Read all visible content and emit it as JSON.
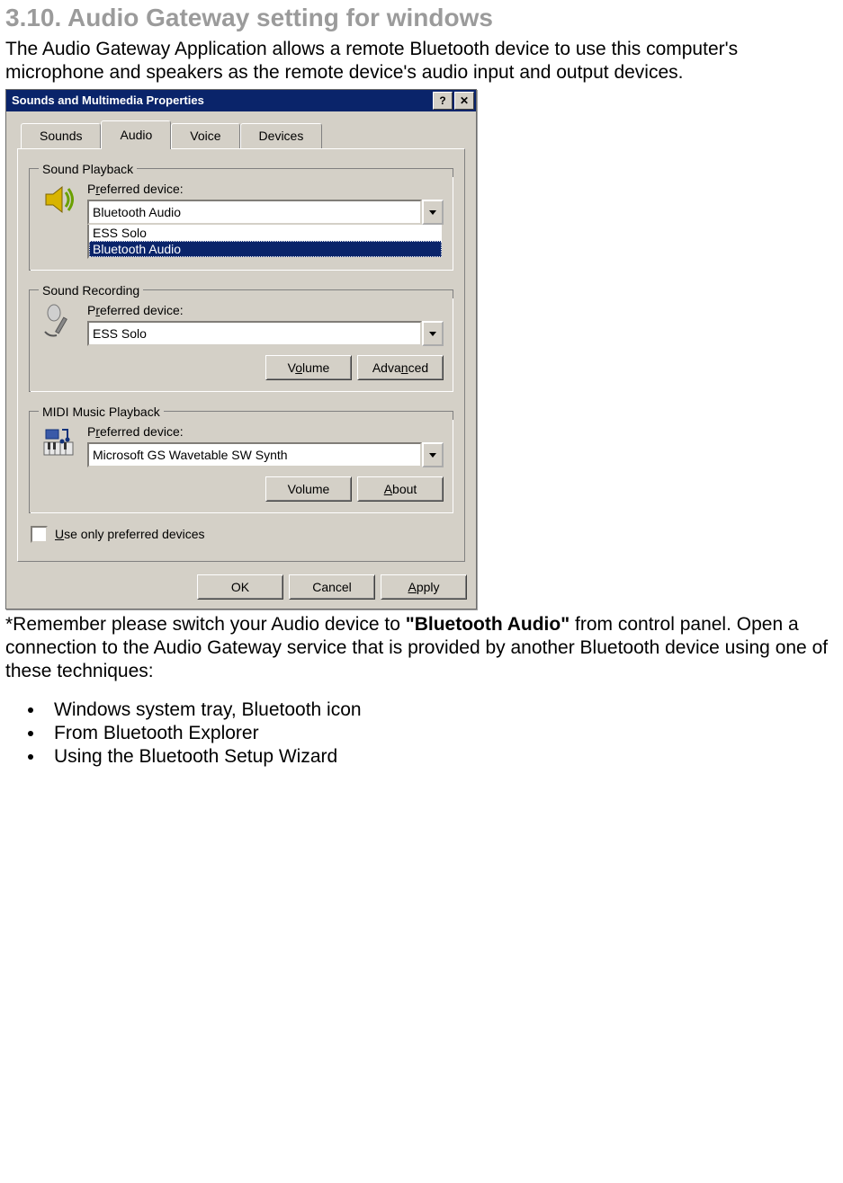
{
  "heading": "3.10. Audio Gateway setting for windows",
  "intro": "The Audio Gateway Application allows a remote Bluetooth device to use this computer's microphone and speakers as the remote device's audio input and output devices.",
  "dialog": {
    "title": "Sounds and Multimedia Properties",
    "help_btn": "?",
    "close_btn": "✕",
    "tabs": {
      "sounds": "Sounds",
      "audio": "Audio",
      "voice": "Voice",
      "devices": "Devices"
    },
    "playback": {
      "legend": "Sound Playback",
      "label_pre": "P",
      "label_u": "r",
      "label_post": "eferred device:",
      "value": "Bluetooth Audio",
      "options": {
        "opt1": "ESS Solo",
        "opt2": "Bluetooth Audio"
      }
    },
    "recording": {
      "legend": "Sound Recording",
      "label_pre": "P",
      "label_u": "r",
      "label_post": "eferred device:",
      "value": "ESS Solo",
      "btn_vol_pre": "V",
      "btn_vol_u": "o",
      "btn_vol_post": "lume",
      "btn_adv_pre": "Adva",
      "btn_adv_u": "n",
      "btn_adv_post": "ced"
    },
    "midi": {
      "legend": "MIDI Music Playback",
      "label_pre": "P",
      "label_u": "r",
      "label_post": "eferred device:",
      "value": "Microsoft GS Wavetable SW Synth",
      "btn_vol": "Volume",
      "btn_about_u": "A",
      "btn_about_post": "bout"
    },
    "use_only_u": "U",
    "use_only_post": "se only preferred devices",
    "footer": {
      "ok": "OK",
      "cancel": "Cancel",
      "apply_u": "A",
      "apply_post": "pply"
    }
  },
  "note_pre": "*Remember please switch your Audio device to ",
  "note_bold": "\"Bluetooth Audio\"",
  "note_post": " from control panel. Open a connection to the Audio Gateway service that is provided by another Bluetooth device using one of these techniques:",
  "techniques": {
    "t1": "Windows system tray, Bluetooth icon",
    "t2": "From Bluetooth Explorer",
    "t3": "Using the Bluetooth Setup Wizard"
  }
}
